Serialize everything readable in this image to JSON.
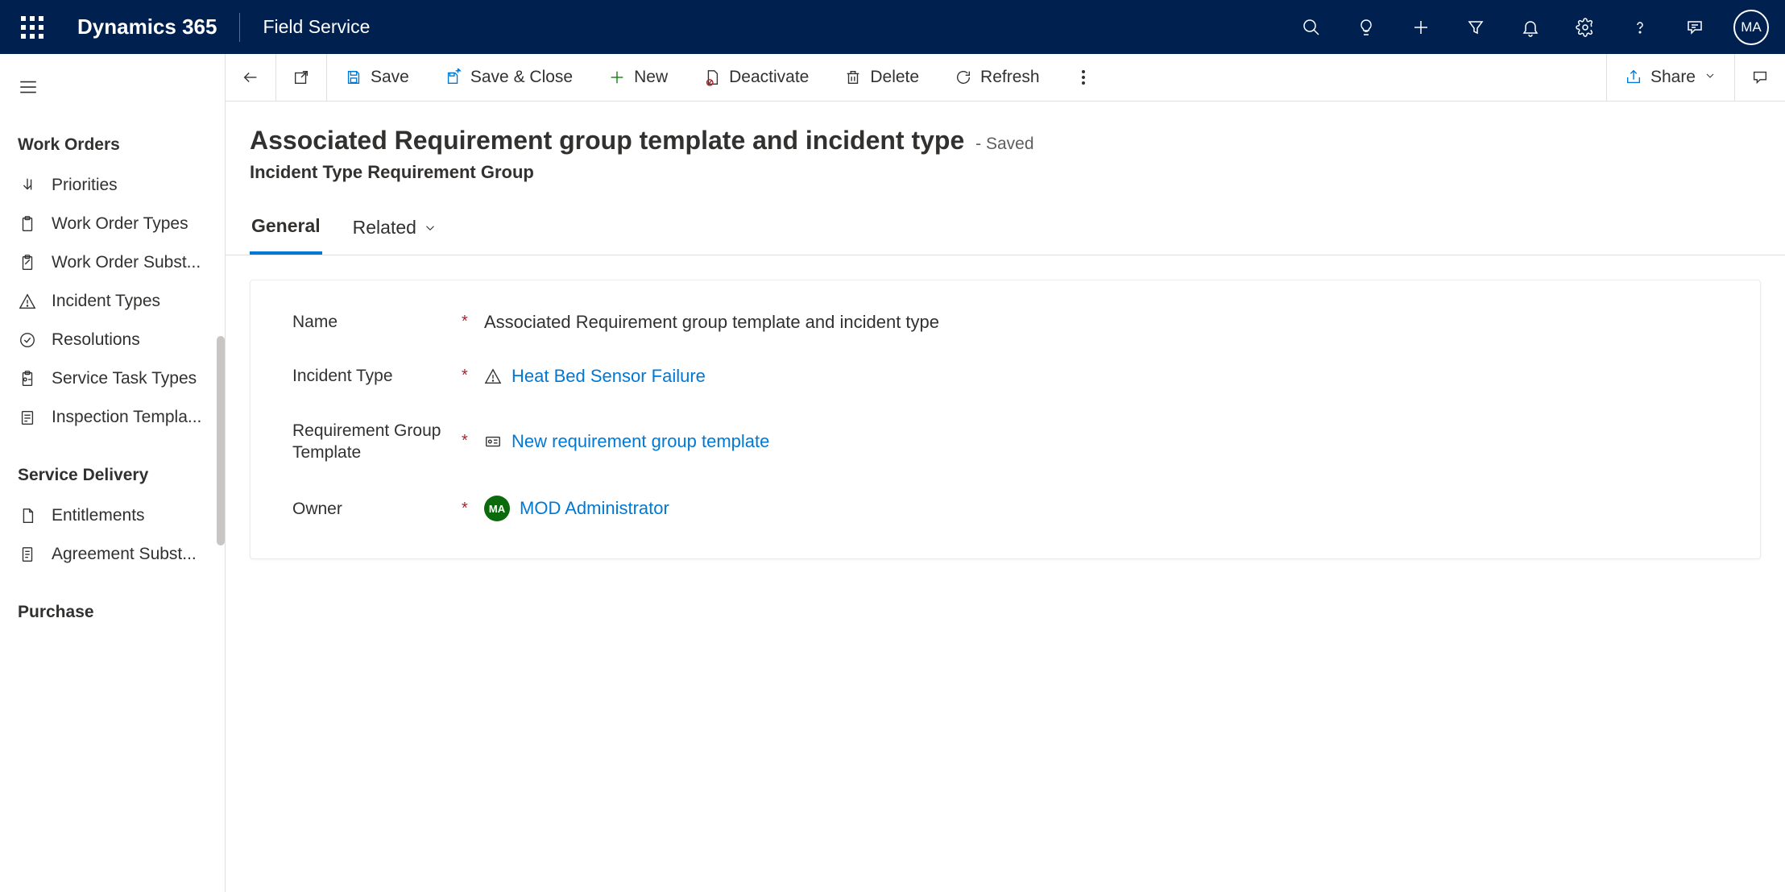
{
  "global_nav": {
    "brand": "Dynamics 365",
    "app_name": "Field Service",
    "avatar_initials": "MA"
  },
  "sidebar": {
    "groups": [
      {
        "header": "Work Orders",
        "items": [
          {
            "label": "Priorities"
          },
          {
            "label": "Work Order Types"
          },
          {
            "label": "Work Order Subst..."
          },
          {
            "label": "Incident Types"
          },
          {
            "label": "Resolutions"
          },
          {
            "label": "Service Task Types"
          },
          {
            "label": "Inspection Templa..."
          }
        ]
      },
      {
        "header": "Service Delivery",
        "items": [
          {
            "label": "Entitlements"
          },
          {
            "label": "Agreement Subst..."
          }
        ]
      },
      {
        "header": "Purchase",
        "items": []
      }
    ]
  },
  "command_bar": {
    "save": "Save",
    "save_close": "Save & Close",
    "new": "New",
    "deactivate": "Deactivate",
    "delete": "Delete",
    "refresh": "Refresh",
    "share": "Share"
  },
  "page": {
    "title": "Associated Requirement group template and incident type",
    "saved_tag": "- Saved",
    "entity_name": "Incident Type Requirement Group"
  },
  "tabs": {
    "general": "General",
    "related": "Related"
  },
  "form": {
    "name_label": "Name",
    "name_value": "Associated Requirement group template and incident type",
    "incident_type_label": "Incident Type",
    "incident_type_value": "Heat Bed Sensor Failure",
    "req_group_label": "Requirement Group Template",
    "req_group_value": "New requirement group template",
    "owner_label": "Owner",
    "owner_value": "MOD Administrator",
    "owner_initials": "MA"
  }
}
